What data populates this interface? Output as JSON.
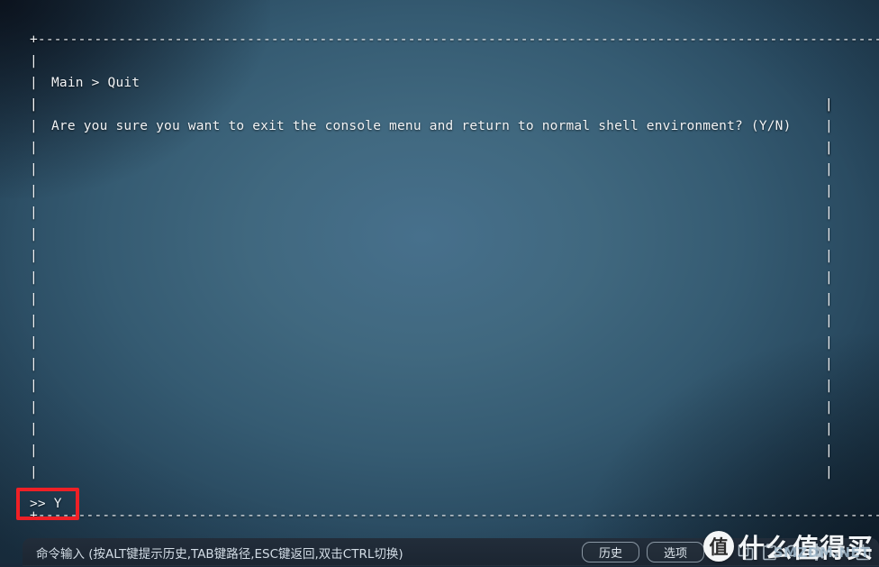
{
  "window": {
    "type": "terminal-console-menu",
    "background_color": "#40687f",
    "text_color": "#f2f4f6"
  },
  "terminal": {
    "border": {
      "corner_char": "+",
      "horizontal_char": "-",
      "vertical_char": "|",
      "top_line": "+-------------------------------------------------------------------------------------------------------------------+",
      "bottom_line": "+-------------------------------------------------------------------------------------------------------------------+"
    },
    "breadcrumb": "Main > Quit",
    "question": "Are you sure you want to exit the console menu and return to normal shell environment? (Y/N)",
    "blank_rows": 18,
    "prompt": {
      "symbol": ">>",
      "value": "Y",
      "full": ">> Y",
      "highlight_color": "#ef2026",
      "highlighted": true
    }
  },
  "statusbar": {
    "hint": "命令输入 (按ALT键提示历史,TAB键路径,ESC键返回,双击CTRL切换)",
    "buttons": [
      {
        "label": "历史",
        "name": "history"
      },
      {
        "label": "选项",
        "name": "options"
      }
    ],
    "icons": [
      {
        "name": "lightning-bolt-icon",
        "color": "#2ecc40"
      },
      {
        "name": "copy-icon",
        "color": "#b9c7d2"
      },
      {
        "name": "paste-icon",
        "color": "#b9c7d2"
      },
      {
        "name": "search-icon",
        "color": "#b9c7d2"
      },
      {
        "name": "gear-icon",
        "color": "#b9c7d2"
      },
      {
        "name": "download-icon",
        "color": "#b9c7d2"
      },
      {
        "name": "upload-icon",
        "color": "#b9c7d2"
      }
    ]
  },
  "watermark": {
    "logo_char": "值",
    "text": "什么值得买",
    "subtext": "SMZDM.NET"
  }
}
